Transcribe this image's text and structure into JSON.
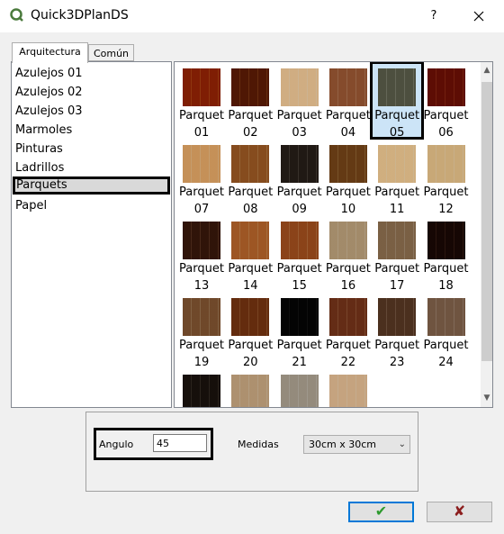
{
  "window": {
    "title": "Quick3DPlanDS",
    "help_label": "?",
    "close_label": "✕"
  },
  "tabs": [
    {
      "label": "Arquitectura",
      "active": true
    },
    {
      "label": "Común",
      "active": false
    }
  ],
  "categories": [
    {
      "label": "Azulejos 01"
    },
    {
      "label": "Azulejos 02"
    },
    {
      "label": "Azulejos 03"
    },
    {
      "label": "Marmoles"
    },
    {
      "label": "Pinturas"
    },
    {
      "label": "Ladrillos"
    },
    {
      "label": "Parquets",
      "selected": true
    },
    {
      "label": "Papel"
    }
  ],
  "textures": [
    {
      "name": "Parquet",
      "num": "01",
      "color": "#b4581e"
    },
    {
      "name": "Parquet",
      "num": "02",
      "color": "#8e4d1f"
    },
    {
      "name": "Parquet",
      "num": "03",
      "color": "#e6d2b6"
    },
    {
      "name": "Parquet",
      "num": "04",
      "color": "#b88a6a"
    },
    {
      "name": "Parquet",
      "num": "05",
      "color": "#8c8e7f",
      "selected": true
    },
    {
      "name": "Parquet",
      "num": "06",
      "color": "#9a3a1e"
    },
    {
      "name": "Parquet",
      "num": "07",
      "color": "#e0c096"
    },
    {
      "name": "Parquet",
      "num": "08",
      "color": "#b98b57"
    },
    {
      "name": "Parquet",
      "num": "09",
      "color": "#5a5048"
    },
    {
      "name": "Parquet",
      "num": "10",
      "color": "#a07a48"
    },
    {
      "name": "Parquet",
      "num": "11",
      "color": "#e6d3b4"
    },
    {
      "name": "Parquet",
      "num": "12",
      "color": "#e2cfae"
    },
    {
      "name": "Parquet",
      "num": "13",
      "color": "#6e4730"
    },
    {
      "name": "Parquet",
      "num": "14",
      "color": "#c89460"
    },
    {
      "name": "Parquet",
      "num": "15",
      "color": "#bc8350"
    },
    {
      "name": "Parquet",
      "num": "16",
      "color": "#cbbca4"
    },
    {
      "name": "Parquet",
      "num": "17",
      "color": "#b09c84"
    },
    {
      "name": "Parquet",
      "num": "18",
      "color": "#4a2a1e"
    },
    {
      "name": "Parquet",
      "num": "19",
      "color": "#a88868"
    },
    {
      "name": "Parquet",
      "num": "20",
      "color": "#a06a3c"
    },
    {
      "name": "Parquet",
      "num": "21",
      "color": "#1e1e1e"
    },
    {
      "name": "Parquet",
      "num": "22",
      "color": "#a06a4a"
    },
    {
      "name": "Parquet",
      "num": "23",
      "color": "#8a6e58"
    },
    {
      "name": "Parquet",
      "num": "24",
      "color": "#a89280"
    },
    {
      "name": "",
      "num": "",
      "color": "#4a3e36"
    },
    {
      "name": "",
      "num": "",
      "color": "#d2c0a8"
    },
    {
      "name": "",
      "num": "",
      "color": "#c2bcb2"
    },
    {
      "name": "",
      "num": "",
      "color": "#e0ccb4"
    }
  ],
  "options": {
    "angle_label": "Angulo",
    "angle_value": "45",
    "size_label": "Medidas",
    "size_value": "30cm x 30cm"
  },
  "buttons": {
    "ok_label": "✔",
    "cancel_label": "✘",
    "ok_color": "#2e9a2e",
    "cancel_color": "#8c1e1e"
  }
}
